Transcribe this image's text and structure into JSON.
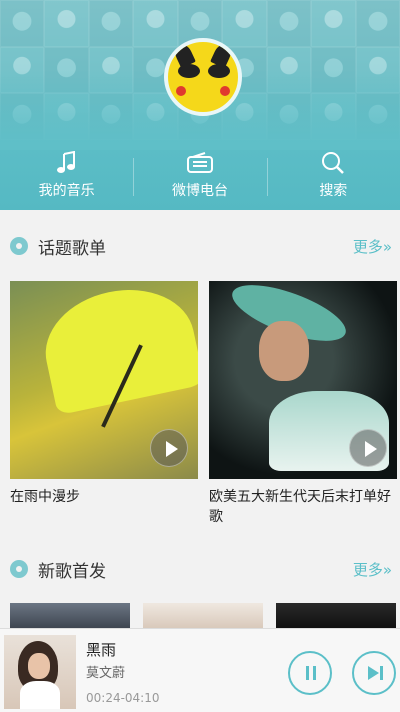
{
  "header": {
    "nav": [
      {
        "label": "我的音乐",
        "icon": "music-note-icon"
      },
      {
        "label": "微博电台",
        "icon": "radio-icon"
      },
      {
        "label": "搜索",
        "icon": "search-icon"
      }
    ]
  },
  "sections": {
    "topics": {
      "title": "话题歌单",
      "more": "更多»",
      "cards": [
        {
          "title": "在雨中漫步"
        },
        {
          "title": "欧美五大新生代天后末打单好歌"
        }
      ]
    },
    "new_songs": {
      "title": "新歌首发",
      "more": "更多»"
    }
  },
  "player": {
    "title": "黑雨",
    "artist": "莫文蔚",
    "time": "00:24-04:10"
  },
  "colors": {
    "accent": "#5bbfc8",
    "header": "#5fbfc8"
  }
}
